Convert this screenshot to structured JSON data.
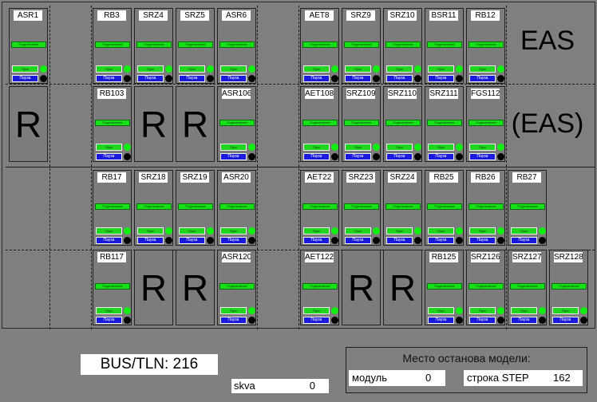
{
  "rows": [
    {
      "slots": [
        {
          "kind": "module",
          "label": "ASR1"
        },
        {
          "kind": "empty"
        },
        {
          "kind": "module",
          "label": "RB3"
        },
        {
          "kind": "module",
          "label": "SRZ4"
        },
        {
          "kind": "module",
          "label": "SRZ5"
        },
        {
          "kind": "module",
          "label": "ASR6"
        },
        {
          "kind": "empty"
        },
        {
          "kind": "module",
          "label": "AET8"
        },
        {
          "kind": "module",
          "label": "SRZ9"
        },
        {
          "kind": "module",
          "label": "SRZ10"
        },
        {
          "kind": "module",
          "label": "BSR11"
        },
        {
          "kind": "module",
          "label": "RB12"
        }
      ]
    },
    {
      "slots": [
        {
          "kind": "reserve",
          "text": "R"
        },
        {
          "kind": "empty"
        },
        {
          "kind": "module",
          "label": "RB103"
        },
        {
          "kind": "reserve",
          "text": "R"
        },
        {
          "kind": "reserve",
          "text": "R"
        },
        {
          "kind": "module",
          "label": "ASR106"
        },
        {
          "kind": "empty"
        },
        {
          "kind": "module",
          "label": "AET108"
        },
        {
          "kind": "module",
          "label": "SRZ109"
        },
        {
          "kind": "module",
          "label": "SRZ110"
        },
        {
          "kind": "module",
          "label": "SRZ111"
        },
        {
          "kind": "module",
          "label": "FGS112"
        }
      ]
    },
    {
      "slots": [
        {
          "kind": "empty"
        },
        {
          "kind": "empty"
        },
        {
          "kind": "module",
          "label": "RB17"
        },
        {
          "kind": "module",
          "label": "SRZ18"
        },
        {
          "kind": "module",
          "label": "SRZ19"
        },
        {
          "kind": "module",
          "label": "ASR20"
        },
        {
          "kind": "empty"
        },
        {
          "kind": "module",
          "label": "AET22"
        },
        {
          "kind": "module",
          "label": "SRZ23"
        },
        {
          "kind": "module",
          "label": "SRZ24"
        },
        {
          "kind": "module",
          "label": "RB25"
        },
        {
          "kind": "module",
          "label": "RB26"
        },
        {
          "kind": "module",
          "label": "RB27"
        }
      ]
    },
    {
      "slots": [
        {
          "kind": "empty"
        },
        {
          "kind": "empty"
        },
        {
          "kind": "module",
          "label": "RB117"
        },
        {
          "kind": "reserve",
          "text": "R"
        },
        {
          "kind": "reserve",
          "text": "R"
        },
        {
          "kind": "module",
          "label": "ASR120"
        },
        {
          "kind": "empty"
        },
        {
          "kind": "module",
          "label": "AET122"
        },
        {
          "kind": "reserve",
          "text": "R"
        },
        {
          "kind": "reserve",
          "text": "R"
        },
        {
          "kind": "module",
          "label": "RB125"
        },
        {
          "kind": "module",
          "label": "SRZ126"
        },
        {
          "kind": "module",
          "label": "SRZ127"
        },
        {
          "kind": "module",
          "label": "SRZ128"
        }
      ]
    }
  ],
  "module_controls": {
    "stripe_label": "Подключение",
    "green_button_label": "Пуск",
    "blue_button_label": "Пауза",
    "status_led_color": "#11ee11",
    "fault_led_color": "#050505"
  },
  "eas_labels": [
    "EAS",
    "(EAS)"
  ],
  "bus_tln": "BUS/TLN: 216",
  "skva": {
    "label": "skva",
    "value": "0"
  },
  "stop_panel": {
    "title": "Место останова модели:",
    "module": {
      "label": "модуль",
      "value": "0"
    },
    "step": {
      "label": "строка STEP",
      "value": "162"
    }
  }
}
